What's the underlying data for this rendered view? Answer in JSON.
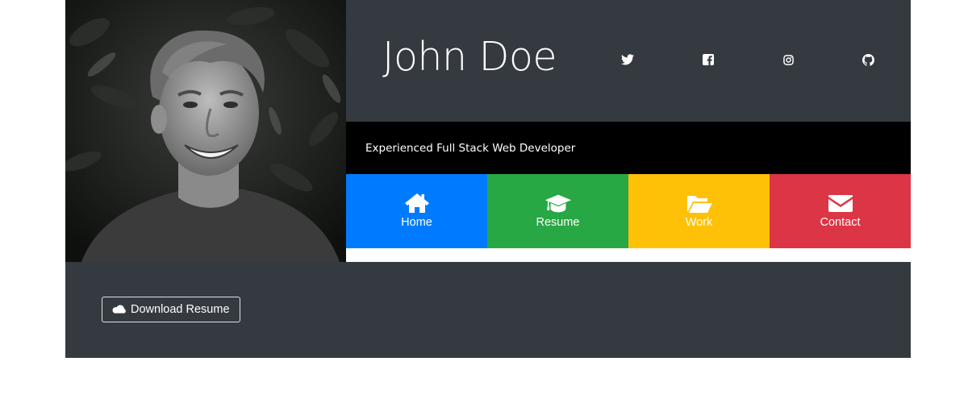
{
  "profile": {
    "name": "John Doe",
    "tagline": "Experienced Full Stack Web Developer",
    "photo": "portrait-photo"
  },
  "social": [
    {
      "icon": "twitter-icon"
    },
    {
      "icon": "facebook-icon"
    },
    {
      "icon": "instagram-icon"
    },
    {
      "icon": "github-icon"
    }
  ],
  "nav": {
    "items": [
      {
        "label": "Home",
        "icon": "home-icon",
        "color": "#007bff"
      },
      {
        "label": "Resume",
        "icon": "graduation-cap-icon",
        "color": "#28a745"
      },
      {
        "label": "Work",
        "icon": "folder-open-icon",
        "color": "#ffc107"
      },
      {
        "label": "Contact",
        "icon": "envelope-icon",
        "color": "#dc3545"
      }
    ]
  },
  "actions": {
    "download_label": "Download Resume",
    "download_icon": "cloud-icon"
  },
  "colors": {
    "header_bg": "#343a40",
    "tagline_bg": "#000000",
    "text": "#ffffff"
  }
}
